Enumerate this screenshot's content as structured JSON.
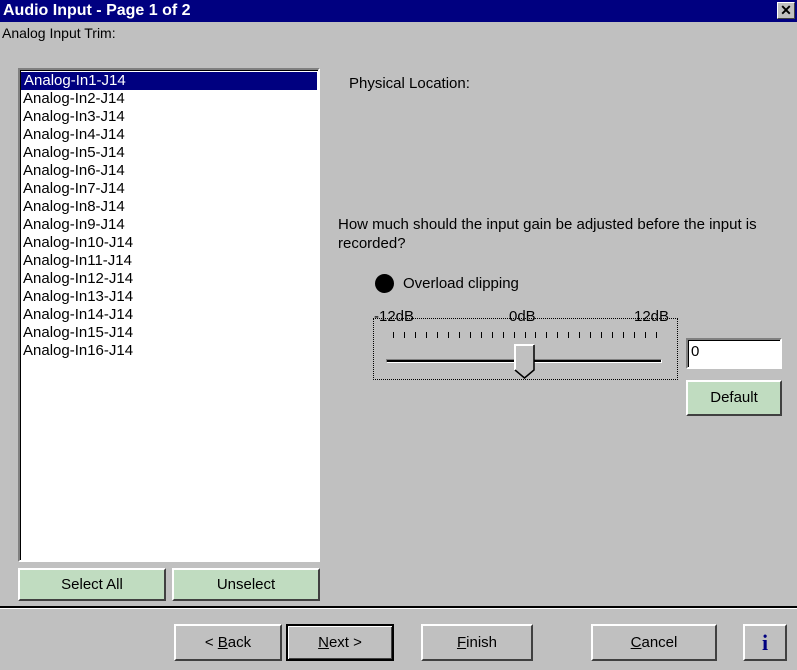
{
  "window": {
    "title": "Audio Input - Page 1 of 2",
    "close_glyph": "✕"
  },
  "list": {
    "caption": "Analog Input Trim:",
    "items": [
      "Analog-In1-J14",
      "Analog-In2-J14",
      "Analog-In3-J14",
      "Analog-In4-J14",
      "Analog-In5-J14",
      "Analog-In6-J14",
      "Analog-In7-J14",
      "Analog-In8-J14",
      "Analog-In9-J14",
      "Analog-In10-J14",
      "Analog-In11-J14",
      "Analog-In12-J14",
      "Analog-In13-J14",
      "Analog-In14-J14",
      "Analog-In15-J14",
      "Analog-In16-J14"
    ],
    "selected_index": 0,
    "select_all_label": "Select All",
    "unselect_label": "Unselect"
  },
  "details": {
    "physical_location_label": "Physical Location:",
    "question": "How much should the input gain be adjusted before the input is recorded?",
    "overload_label": "Overload clipping"
  },
  "slider": {
    "min_label": "-12dB",
    "mid_label": "0dB",
    "max_label": "12dB",
    "min": -12,
    "max": 12,
    "value": 0,
    "value_text": "0",
    "default_label": "Default"
  },
  "nav": {
    "back": {
      "accel": "B",
      "rest": "ack",
      "prefix": "< "
    },
    "next": {
      "accel": "N",
      "rest": "ext >"
    },
    "finish": {
      "accel": "F",
      "rest": "inish"
    },
    "cancel": {
      "accel": "C",
      "rest": "ancel"
    },
    "info_glyph": "i"
  },
  "colors": {
    "titlebar": "#000080",
    "selection": "#000080",
    "face": "#c0c0c0",
    "green_button": "#c0dcc0"
  }
}
